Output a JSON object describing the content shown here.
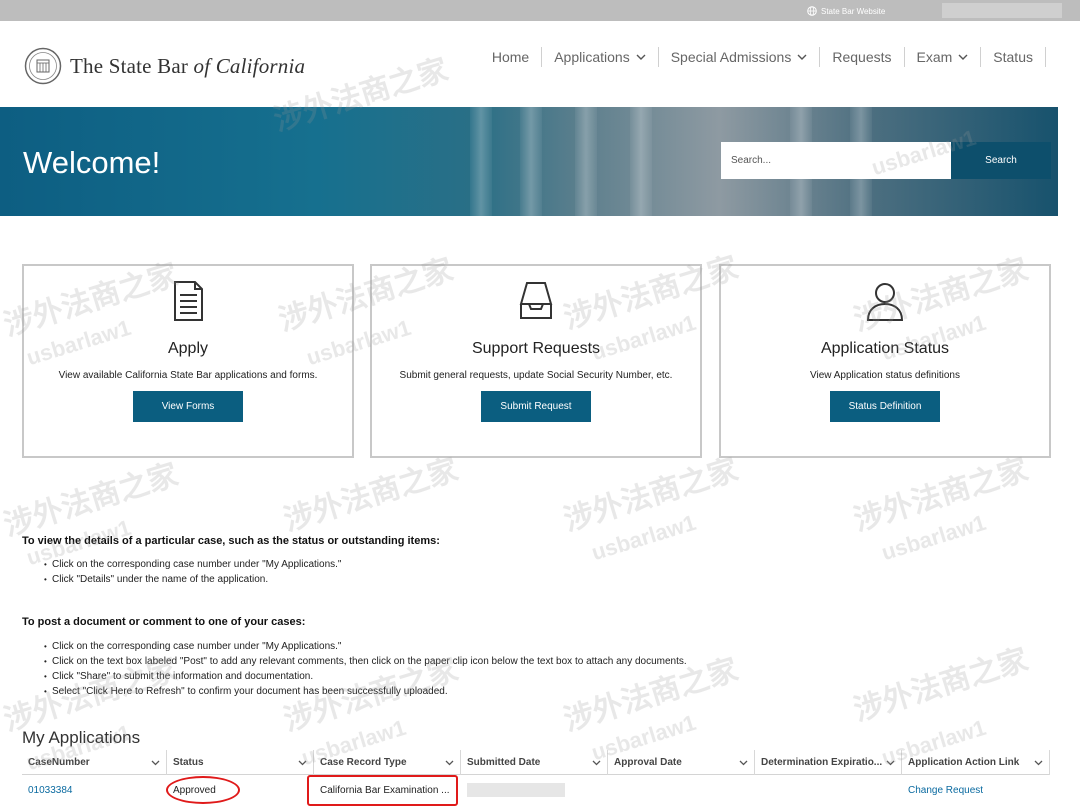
{
  "topbar": {
    "link_label": "State Bar Website"
  },
  "logo": {
    "text_main": "The State Bar ",
    "text_italic": "of California"
  },
  "nav": {
    "home": "Home",
    "applications": "Applications",
    "special_admissions": "Special Admissions",
    "requests": "Requests",
    "exam": "Exam",
    "status": "Status"
  },
  "hero": {
    "title": "Welcome!",
    "search_placeholder": "Search...",
    "search_button": "Search"
  },
  "cards": [
    {
      "title": "Apply",
      "description": "View available California State Bar applications and forms.",
      "button": "View Forms"
    },
    {
      "title": "Support Requests",
      "description": "Submit general requests, update Social Security Number, etc.",
      "button": "Submit Request"
    },
    {
      "title": "Application Status",
      "description": "View Application status definitions",
      "button": "Status Definition"
    }
  ],
  "instructions": [
    {
      "heading": "To view the details of a particular case, such as the status or outstanding items:",
      "items": [
        "Click on the corresponding case number under \"My Applications.\"",
        "Click \"Details\" under the name of the application."
      ]
    },
    {
      "heading": "To post a document or comment to one of your cases:",
      "items": [
        "Click on the corresponding case number under \"My Applications.\"",
        "Click on the text box labeled \"Post\" to add any relevant comments, then click on the paper clip icon below the text box to attach any documents.",
        "Click \"Share\" to submit the information and documentation.",
        "Select \"Click Here to Refresh\" to confirm your document has been successfully uploaded."
      ]
    }
  ],
  "applications": {
    "title": "My Applications",
    "columns": [
      "CaseNumber",
      "Status",
      "Case Record Type",
      "Submitted Date",
      "Approval Date",
      "Determination Expiratio...",
      "Application Action Link"
    ],
    "rows": [
      {
        "case_number": "01033384",
        "status": "Approved",
        "record_type": "California Bar Examination ...",
        "submitted_date": "",
        "approval_date": "",
        "expiration": "",
        "action_link": "Change Request"
      }
    ]
  },
  "watermark": {
    "cn": "涉外法商之家",
    "en": "usbarlaw1"
  },
  "colors": {
    "primary": "#0b5e80",
    "hero": "#0d5e82",
    "highlight": "#e01a1a",
    "link": "#0a6aa0"
  }
}
